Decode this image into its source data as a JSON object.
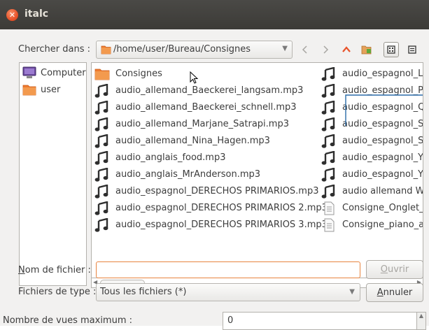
{
  "window": {
    "title": "italc"
  },
  "lookin": {
    "label": "Chercher dans :",
    "path": "/home/user/Bureau/Consignes"
  },
  "sidebar": {
    "items": [
      {
        "label": "Computer",
        "icon": "computer-icon"
      },
      {
        "label": "user",
        "icon": "folder-icon"
      }
    ]
  },
  "files": {
    "column1": [
      {
        "name": "Consignes",
        "icon": "folder-icon"
      },
      {
        "name": "audio_allemand_Baeckerei_langsam.mp3",
        "icon": "music-note-icon"
      },
      {
        "name": "audio_allemand_Baeckerei_schnell.mp3",
        "icon": "music-note-icon"
      },
      {
        "name": "audio_allemand_Marjane_Satrapi.mp3",
        "icon": "music-note-icon"
      },
      {
        "name": "audio_allemand_Nina_Hagen.mp3",
        "icon": "music-note-icon"
      },
      {
        "name": "audio_anglais_food.mp3",
        "icon": "music-note-icon"
      },
      {
        "name": "audio_anglais_MrAnderson.mp3",
        "icon": "music-note-icon"
      },
      {
        "name": "audio_espagnol_DERECHOS PRIMARIOS.mp3",
        "icon": "music-note-icon"
      },
      {
        "name": "audio_espagnol_DERECHOS PRIMARIOS 2.mp3",
        "icon": "music-note-icon"
      },
      {
        "name": "audio_espagnol_DERECHOS PRIMARIOS 3.mp3",
        "icon": "music-note-icon"
      }
    ],
    "column2": [
      {
        "name": "audio_espagnol_L",
        "icon": "music-note-icon"
      },
      {
        "name": "audio_espagnol_P",
        "icon": "music-note-icon"
      },
      {
        "name": "audio_espagnol_Q",
        "icon": "music-note-icon"
      },
      {
        "name": "audio_espagnol_S",
        "icon": "music-note-icon"
      },
      {
        "name": "audio_espagnol_S",
        "icon": "music-note-icon"
      },
      {
        "name": "audio_espagnol_Y",
        "icon": "music-note-icon"
      },
      {
        "name": "audio_espagnol_Y",
        "icon": "music-note-icon"
      },
      {
        "name": "audio allemand Wi",
        "icon": "music-note-icon"
      },
      {
        "name": "Consigne_Onglet_I",
        "icon": "document-icon"
      },
      {
        "name": "Consigne_piano_a",
        "icon": "document-icon"
      }
    ]
  },
  "scrollbar": {
    "thumb_label": "....."
  },
  "filename": {
    "label": "Nom de fichier :",
    "label_mnemonic": "N",
    "label_rest": "om de fichier :",
    "value": ""
  },
  "filetype": {
    "label": "Fichiers de type :",
    "value": "Tous les fichiers (*)"
  },
  "buttons": {
    "open": {
      "mnemonic": "O",
      "rest": "uvrir"
    },
    "cancel": {
      "mnemonic": "A",
      "rest": "nnuler"
    }
  },
  "maxviews": {
    "label": "Nombre de vues maximum :",
    "value": "0"
  },
  "colors": {
    "accent": "#e8532a",
    "focus_border": "#e8843f",
    "folder": "#ee7b2f",
    "nav_up": "#e8532a"
  }
}
